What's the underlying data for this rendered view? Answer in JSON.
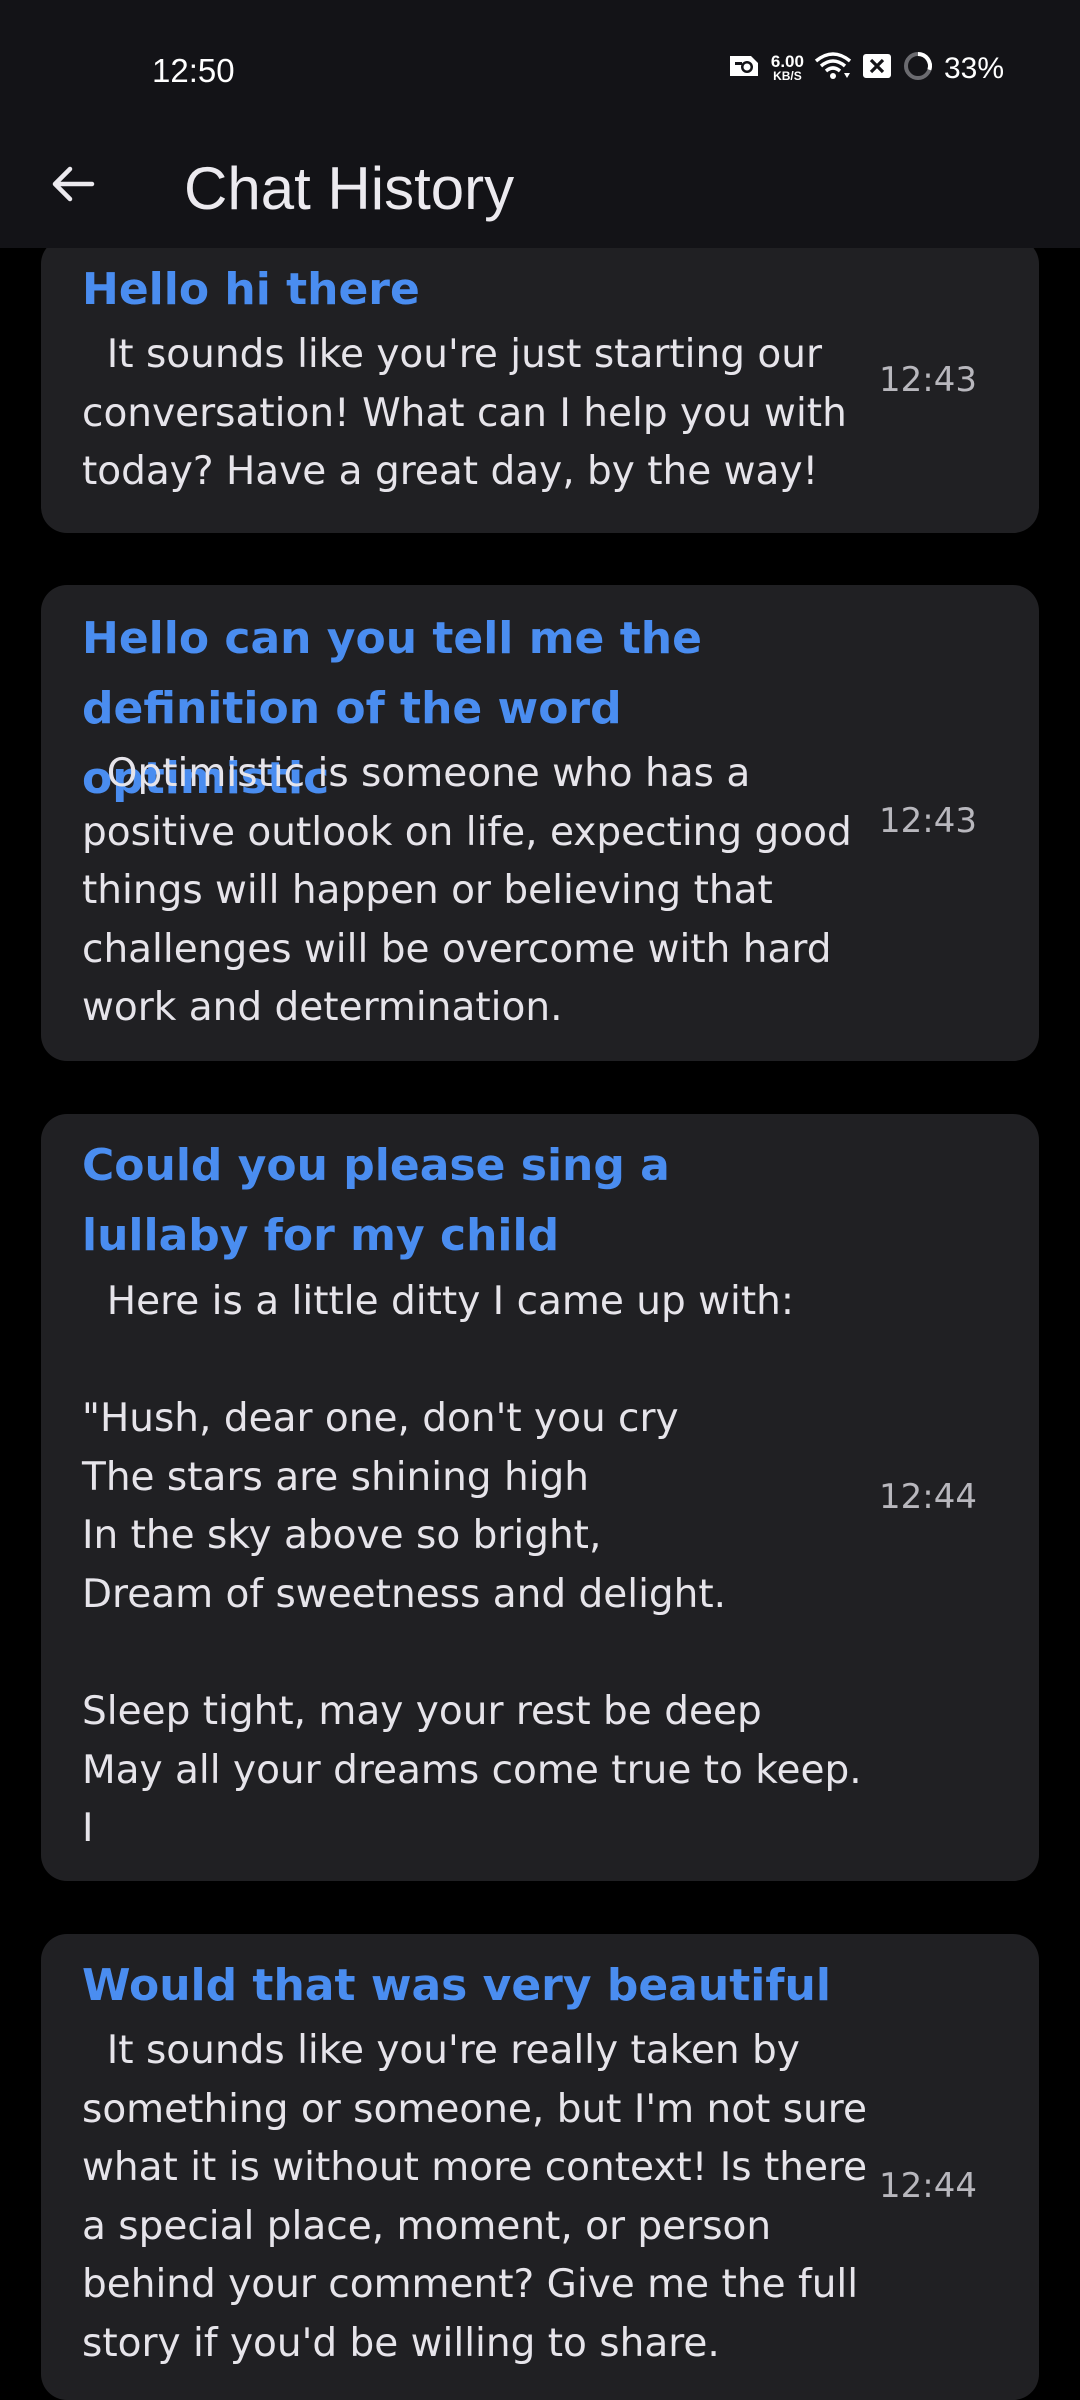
{
  "status_bar": {
    "time": "12:50",
    "net_speed_value": "6.00",
    "net_speed_unit": "KB/S",
    "battery": "33%",
    "icons": [
      "sim-icon",
      "wifi-icon",
      "notification-x-icon",
      "battery-ring-icon"
    ]
  },
  "app_bar": {
    "back_icon": "arrow-left-icon",
    "title": "Chat History"
  },
  "chats": [
    {
      "title": "Hello hi there",
      "body": "  It sounds like you're just starting our\nconversation! What can I help you with\ntoday? Have a great day, by the way!",
      "time": "12:43"
    },
    {
      "title": "Hello can you tell me the definition of the word optimistic",
      "body": "  Optimistic is someone who has a\npositive outlook on life, expecting good\nthings will happen or believing that\nchallenges will be overcome with hard\nwork and determination.",
      "time": "12:43"
    },
    {
      "title": "Could you please sing a lullaby for my child",
      "body": "  Here is a little ditty I came up with:\n\n\"Hush, dear one, don't you cry\nThe stars are shining high\nIn the sky above so bright,\nDream of sweetness and delight.\n\nSleep tight, may your rest be deep\nMay all your dreams come true to keep.\nI",
      "time": "12:44"
    },
    {
      "title": "Would that was very beautiful",
      "body": "  It sounds like you're really taken by\nsomething or someone, but I'm not sure\nwhat it is without more context! Is there\na special place, moment, or person\nbehind your comment? Give me the full\nstory if you'd be willing to share.",
      "time": "12:44"
    }
  ],
  "colors": {
    "background": "#000000",
    "bar": "#131317",
    "card": "#202023",
    "title_accent": "#4a8df0",
    "body_text": "#e6e4ea",
    "time_text": "#b8b7bd"
  }
}
